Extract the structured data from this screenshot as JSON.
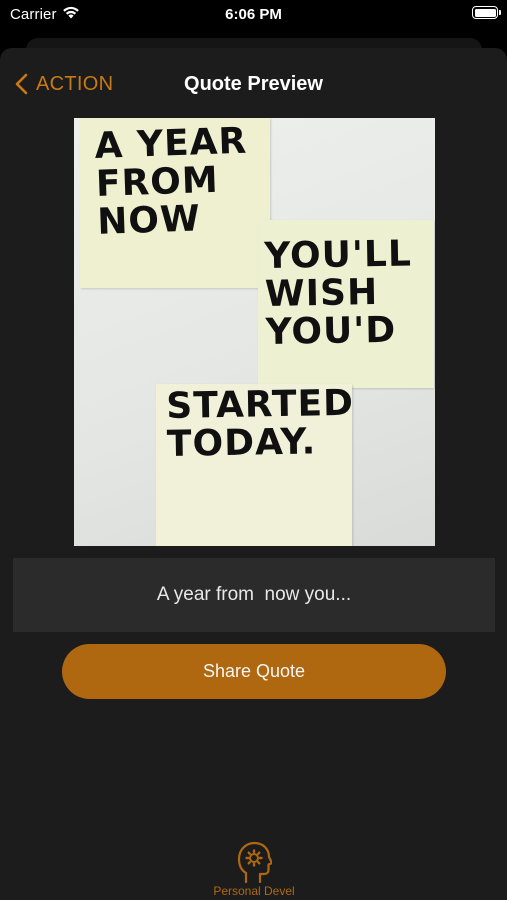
{
  "status_bar": {
    "carrier": "Carrier",
    "time": "6:06 PM",
    "wifi_icon": "wifi-icon",
    "battery_icon": "battery-icon",
    "battery_level": 1.0
  },
  "nav": {
    "back_label": "ACTION",
    "back_icon": "chevron-left-icon",
    "title": "Quote Preview"
  },
  "quote_image": {
    "lines_note_a": "A YEAR\nFROM\nNOW",
    "lines_note_b": "YOU'LL\nWISH\nYOU'D",
    "lines_note_c": "STARTED\nTODAY."
  },
  "caption": {
    "text": "A year from  now you..."
  },
  "share_button": {
    "label": "Share Quote"
  },
  "tab_bar": {
    "items": [
      {
        "label": "Personal Devel",
        "icon": "head-gear-icon"
      }
    ]
  },
  "colors": {
    "accent": "#b06810",
    "accent_text": "#c97a12",
    "background": "#1c1c1c",
    "caption_bg": "#2b2b2b"
  }
}
